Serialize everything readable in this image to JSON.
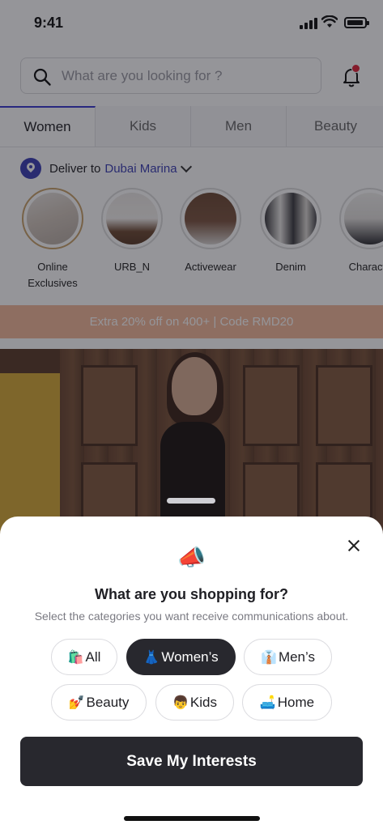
{
  "status_bar": {
    "time": "9:41"
  },
  "search": {
    "placeholder": "What are you looking for ?"
  },
  "tabs": [
    {
      "label": "Women",
      "active": true
    },
    {
      "label": "Kids",
      "active": false
    },
    {
      "label": "Men",
      "active": false
    },
    {
      "label": "Beauty",
      "active": false
    }
  ],
  "delivery": {
    "label": "Deliver to",
    "location": "Dubai Marina"
  },
  "stories": [
    {
      "label": "Online Exclusives"
    },
    {
      "label": "URB_N"
    },
    {
      "label": "Activewear"
    },
    {
      "label": "Denim"
    },
    {
      "label": "Characte"
    }
  ],
  "promo": {
    "text": "Extra 20% off on 400+ | Code RMD20"
  },
  "sheet": {
    "icon": "📣",
    "title": "What are you shopping for?",
    "subtitle": "Select the categories you want receive communications about.",
    "chips": [
      {
        "emoji": "🛍️",
        "label": "All",
        "selected": false
      },
      {
        "emoji": "👗",
        "label": "Women’s",
        "selected": true
      },
      {
        "emoji": "👔",
        "label": "Men’s",
        "selected": false
      },
      {
        "emoji": "💅",
        "label": "Beauty",
        "selected": false
      },
      {
        "emoji": "👦",
        "label": "Kids",
        "selected": false
      },
      {
        "emoji": "🛋️",
        "label": "Home",
        "selected": false
      }
    ],
    "save_label": "Save My Interests"
  },
  "colors": {
    "accent": "#3b3fb4",
    "dark": "#28282e",
    "promo": "#f3b89a",
    "notification": "#e0233a"
  }
}
